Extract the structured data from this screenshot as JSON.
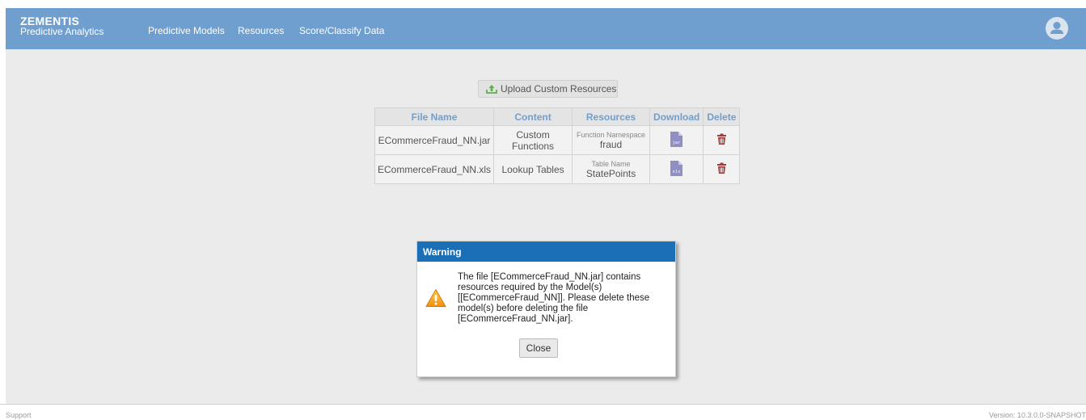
{
  "brand": {
    "title": "ZEMENTIS",
    "subtitle": "Predictive Analytics"
  },
  "nav": {
    "items": [
      "Predictive Models",
      "Resources",
      "Score/Classify Data"
    ]
  },
  "upload": {
    "label": "Upload Custom Resources"
  },
  "table": {
    "headers": [
      "File Name",
      "Content",
      "Resources",
      "Download",
      "Delete"
    ],
    "rows": [
      {
        "file_name": "ECommerceFraud_NN.jar",
        "content": "Custom Functions",
        "resource_label": "Function Namespace",
        "resource_value": "fraud",
        "download_icon": "jar-file-icon",
        "download_ext": "jar"
      },
      {
        "file_name": "ECommerceFraud_NN.xls",
        "content": "Lookup Tables",
        "resource_label": "Table Name",
        "resource_value": "StatePoints",
        "download_icon": "xls-file-icon",
        "download_ext": "xls"
      }
    ]
  },
  "dialog": {
    "title": "Warning",
    "message": "The file [ECommerceFraud_NN.jar] contains resources required by the Model(s) [[ECommerceFraud_NN]]. Please delete these model(s) before deleting the file [ECommerceFraud_NN.jar].",
    "close_label": "Close"
  },
  "footer": {
    "support": "Support",
    "version": "Version: 10.3.0.0-SNAPSHOT"
  },
  "colors": {
    "topbar": "#6f9fcf",
    "dialog_header": "#1a6fb6",
    "delete_icon": "#a33a3a",
    "header_text": "#6f9fcf"
  }
}
